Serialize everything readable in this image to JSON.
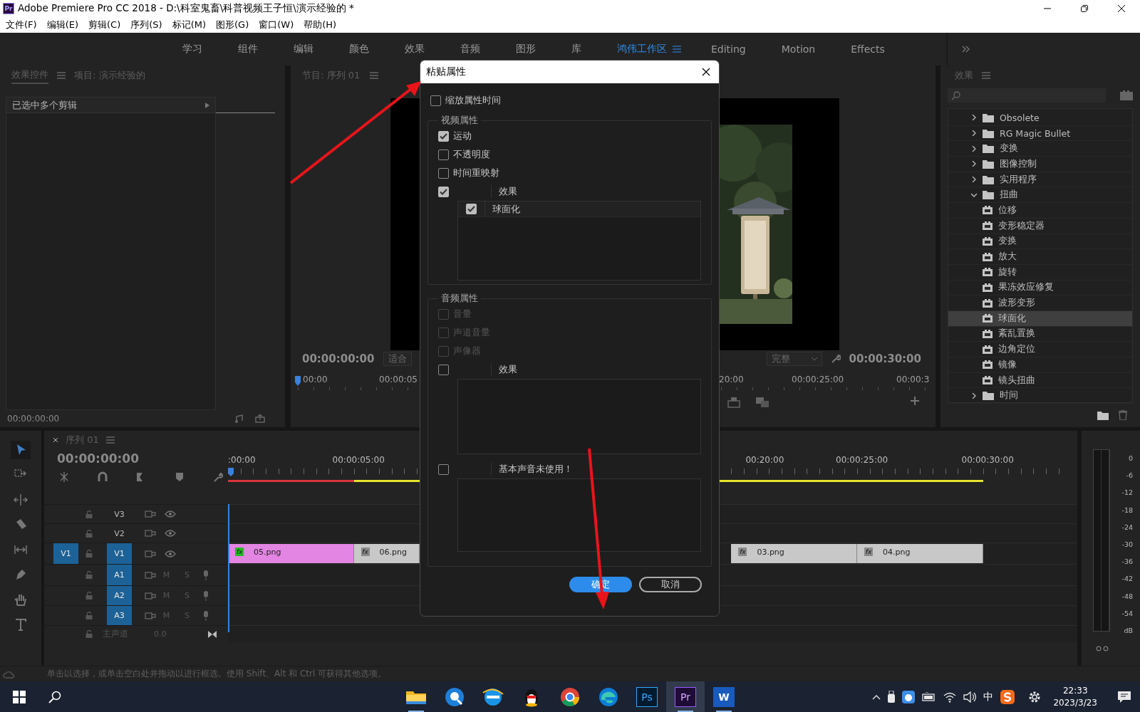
{
  "window": {
    "app_badge": "Pr",
    "title": "Adobe Premiere Pro CC 2018 - D:\\科室鬼畜\\科普视频王子恒\\演示经验的 *"
  },
  "menu": [
    "文件(F)",
    "编辑(E)",
    "剪辑(C)",
    "序列(S)",
    "标记(M)",
    "图形(G)",
    "窗口(W)",
    "帮助(H)"
  ],
  "workspaces": [
    {
      "label": "学习",
      "selected": false
    },
    {
      "label": "组件",
      "selected": false
    },
    {
      "label": "编辑",
      "selected": false
    },
    {
      "label": "颜色",
      "selected": false
    },
    {
      "label": "效果",
      "selected": false
    },
    {
      "label": "音频",
      "selected": false
    },
    {
      "label": "图形",
      "selected": false
    },
    {
      "label": "库",
      "selected": false
    },
    {
      "label": "鸿伟工作区",
      "selected": true
    },
    {
      "label": "Editing",
      "selected": false
    },
    {
      "label": "Motion",
      "selected": false
    },
    {
      "label": "Effects",
      "selected": false
    }
  ],
  "effect_controls": {
    "tabs": [
      {
        "label": "效果控件",
        "selected": true
      },
      {
        "label": "项目: 演示经验的",
        "selected": false
      }
    ],
    "clip_header": "已选中多个剪辑",
    "timecode": "00:00:00:00"
  },
  "program_monitor": {
    "title": "节目: 序列 01",
    "timecode": "00:00:00:00",
    "fit": "适合",
    "quality": "完整",
    "duration": "00:00:30:00",
    "ruler": [
      "00:00",
      "00:00:05",
      "20:00",
      "00:00:25:00",
      "00:00:3"
    ]
  },
  "effects_panel": {
    "title": "效果",
    "tree": [
      {
        "label": "Obsolete",
        "expanded": false
      },
      {
        "label": "RG Magic Bullet",
        "expanded": false
      },
      {
        "label": "变换",
        "expanded": false
      },
      {
        "label": "图像控制",
        "expanded": false
      },
      {
        "label": "实用程序",
        "expanded": false
      },
      {
        "label": "扭曲",
        "expanded": true,
        "children": [
          {
            "label": "位移",
            "selected": false
          },
          {
            "label": "变形稳定器",
            "selected": false
          },
          {
            "label": "变换",
            "selected": false
          },
          {
            "label": "放大",
            "selected": false
          },
          {
            "label": "旋转",
            "selected": false
          },
          {
            "label": "果冻效应修复",
            "selected": false
          },
          {
            "label": "波形变形",
            "selected": false
          },
          {
            "label": "球面化",
            "selected": true
          },
          {
            "label": "紊乱置换",
            "selected": false
          },
          {
            "label": "边角定位",
            "selected": false
          },
          {
            "label": "镜像",
            "selected": false
          },
          {
            "label": "镜头扭曲",
            "selected": false
          }
        ]
      },
      {
        "label": "时间",
        "expanded": false
      }
    ]
  },
  "timeline": {
    "title": "序列 01",
    "timecode": "00:00:00:00",
    "ruler": [
      ":00:00",
      "00:00:05:00",
      "00:20:00",
      "00:00:25:00",
      "00:00:30:00"
    ],
    "tracks": [
      {
        "kind": "video",
        "name": "V3",
        "targeted": false
      },
      {
        "kind": "video",
        "name": "V2",
        "targeted": false
      },
      {
        "kind": "video",
        "name": "V1",
        "targeted": true,
        "source": "V1"
      },
      {
        "kind": "audio",
        "name": "A1",
        "targeted": true,
        "buttons": [
          "M",
          "S"
        ]
      },
      {
        "kind": "audio",
        "name": "A2",
        "targeted": true,
        "buttons": [
          "M",
          "S"
        ]
      },
      {
        "kind": "audio",
        "name": "A3",
        "targeted": true,
        "buttons": [
          "M",
          "S"
        ]
      },
      {
        "kind": "master",
        "name": "主声道",
        "value": "0.0"
      }
    ],
    "clips": [
      {
        "name": "05.png",
        "badge": "fx",
        "color": "#e385e3",
        "effect_applied": true
      },
      {
        "name": "06.png",
        "badge": "fx",
        "color": "#c8c8c8",
        "effect_applied": false
      },
      {
        "name": "03.png",
        "badge": "fx",
        "color": "#c8c8c8",
        "effect_applied": false
      },
      {
        "name": "04.png",
        "badge": "fx",
        "color": "#c8c8c8",
        "effect_applied": false
      }
    ]
  },
  "audio_meter": {
    "scale": [
      "0",
      "-6",
      "-12",
      "-18",
      "-24",
      "-30",
      "-36",
      "-42",
      "-48",
      "-54",
      "dB"
    ]
  },
  "status_bar": "单击以选择，或单击空白处并拖动以进行框选。使用 Shift、Alt 和 Ctrl 可获得其他选项。",
  "dialog": {
    "title": "粘贴属性",
    "scale_times": {
      "label": "缩放属性时间",
      "checked": false
    },
    "video": {
      "title": "视频属性",
      "items": [
        {
          "label": "运动",
          "checked": true,
          "disabled": false
        },
        {
          "label": "不透明度",
          "checked": false,
          "disabled": false
        },
        {
          "label": "时间重映射",
          "checked": false,
          "disabled": false
        }
      ],
      "effects": {
        "checked": true,
        "header": "效果",
        "list": [
          {
            "label": "球面化",
            "checked": true
          }
        ]
      }
    },
    "audio": {
      "title": "音频属性",
      "items": [
        {
          "label": "音量",
          "checked": false,
          "disabled": true
        },
        {
          "label": "声道音量",
          "checked": false,
          "disabled": true
        },
        {
          "label": "声像器",
          "checked": false,
          "disabled": true
        }
      ],
      "effects": {
        "checked": false,
        "header": "效果"
      },
      "essential": {
        "checked": false,
        "header": "基本声音未使用！"
      }
    },
    "buttons": [
      {
        "label": "确定",
        "kind": "primary"
      },
      {
        "label": "取消",
        "kind": "secondary"
      }
    ]
  },
  "taskbar": {
    "apps": [
      {
        "kind": "folder",
        "running": true,
        "selected": false
      },
      {
        "kind": "swirl",
        "running": false,
        "selected": false
      },
      {
        "kind": "ie",
        "running": false,
        "selected": false
      },
      {
        "kind": "penguin",
        "running": false,
        "selected": false
      },
      {
        "kind": "chrome",
        "running": false,
        "selected": false
      },
      {
        "kind": "edge",
        "running": false,
        "selected": false
      },
      {
        "kind": "ps",
        "label": "Ps",
        "running": false,
        "selected": false
      },
      {
        "kind": "pr",
        "label": "Pr",
        "running": true,
        "selected": true
      },
      {
        "kind": "word",
        "label": "W",
        "running": true,
        "selected": false
      }
    ],
    "ime": "中",
    "time": "22:33",
    "date": "2023/3/23"
  }
}
